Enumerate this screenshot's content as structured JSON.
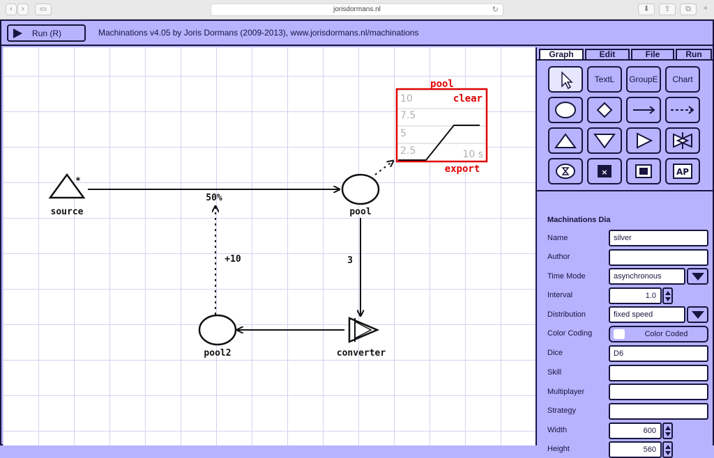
{
  "browser": {
    "url": "jorisdormans.nl"
  },
  "toolbar": {
    "run_label": "Run (R)",
    "title": "Machinations v4.05 by Joris Dormans (2009-2013), www.jorisdormans.nl/machinations"
  },
  "canvas": {
    "nodes": {
      "source": "source",
      "source_marker": "*",
      "pool": "pool",
      "pool2": "pool2",
      "converter": "converter"
    },
    "edges": {
      "source_to_pool": "50%",
      "pool2_to_source_edge": "+10",
      "pool_to_converter": "3"
    },
    "chart_widget": {
      "title": "pool",
      "clear_label": "clear",
      "export_label": "export",
      "time_label": "10 s",
      "y_ticks": [
        "10",
        "7.5",
        "5",
        "2.5"
      ],
      "accent_color": "#e00000"
    }
  },
  "tabs": [
    "Graph",
    "Edit",
    "File",
    "Run"
  ],
  "tools": {
    "text_label": "TextL",
    "group_label": "GroupE",
    "chart_label": "Chart",
    "ap_label": "AP"
  },
  "properties": {
    "section_title": "Machinations Dia",
    "fields": {
      "name": {
        "label": "Name",
        "value": "silver"
      },
      "author": {
        "label": "Author",
        "value": ""
      },
      "time_mode": {
        "label": "Time Mode",
        "value": "asynchronous"
      },
      "interval": {
        "label": "Interval",
        "value": "1.0"
      },
      "distribution": {
        "label": "Distribution",
        "value": "fixed speed"
      },
      "color_coding": {
        "label": "Color Coding",
        "value": "Color Coded"
      },
      "dice": {
        "label": "Dice",
        "value": "D6"
      },
      "skill": {
        "label": "Skill",
        "value": ""
      },
      "multiplayer": {
        "label": "Multiplayer",
        "value": ""
      },
      "strategy": {
        "label": "Strategy",
        "value": ""
      },
      "width": {
        "label": "Width",
        "value": "600"
      },
      "height": {
        "label": "Height",
        "value": "560"
      }
    }
  },
  "colors": {
    "accent": "#b7b3ff",
    "ink": "#17143f",
    "chart_red": "#e00000"
  }
}
